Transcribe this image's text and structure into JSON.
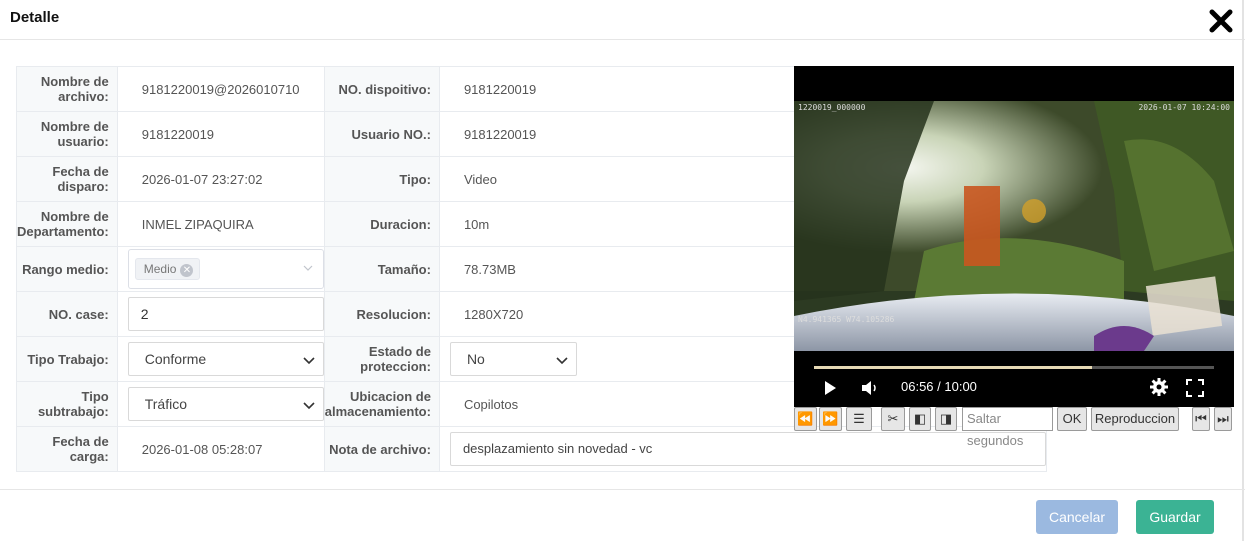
{
  "header": {
    "title": "Detalle"
  },
  "fields": {
    "nombre_archivo": {
      "label": "Nombre de archivo:",
      "value": "9181220019@2026010710"
    },
    "no_dispositivo": {
      "label": "NO. dispoitivo:",
      "value": "9181220019"
    },
    "nombre_usuario": {
      "label": "Nombre de usuario:",
      "value": "9181220019"
    },
    "usuario_no": {
      "label": "Usuario NO.:",
      "value": "9181220019"
    },
    "fecha_disparo": {
      "label": "Fecha de disparo:",
      "value": "2026-01-07 23:27:02"
    },
    "tipo": {
      "label": "Tipo:",
      "value": "Video"
    },
    "departamento": {
      "label": "Nombre de Departamento:",
      "value": "INMEL ZIPAQUIRA"
    },
    "duracion": {
      "label": "Duracion:",
      "value": "10m"
    },
    "rango_medio": {
      "label": "Rango medio:",
      "tag": "Medio"
    },
    "tamano": {
      "label": "Tamaño:",
      "value": "78.73MB"
    },
    "no_case": {
      "label": "NO. case:",
      "value": "2"
    },
    "resolucion": {
      "label": "Resolucion:",
      "value": "1280X720"
    },
    "tipo_trabajo": {
      "label": "Tipo Trabajo:",
      "value": "Conforme"
    },
    "estado_proteccion": {
      "label": "Estado de proteccion:",
      "value": "No"
    },
    "tipo_subtrabajo": {
      "label": "Tipo subtrabajo:",
      "value": "Tráfico"
    },
    "ubicacion": {
      "label": "Ubicacion de almacenamiento:",
      "value": "Copilotos"
    },
    "fecha_carga": {
      "label": "Fecha de carga:",
      "value": "2026-01-08 05:28:07"
    },
    "nota": {
      "label": "Nota de archivo:",
      "value": "desplazamiento sin novedad - vc"
    }
  },
  "video": {
    "osd_top_left": "1220019_000000",
    "osd_top_right": "2026-01-07 10:24:00",
    "osd_bottom_left": "N4.941365 W74.105286",
    "time": "06:56 / 10:00",
    "progress": 0.694
  },
  "toolbar": {
    "seek_placeholder": "Saltar segundos",
    "ok_label": "OK",
    "playback_label": "Reproduccion"
  },
  "footer": {
    "cancel_label": "Cancelar",
    "save_label": "Guardar"
  },
  "colors": {
    "cancel": "#9bb9e0",
    "save": "#3bb394"
  }
}
